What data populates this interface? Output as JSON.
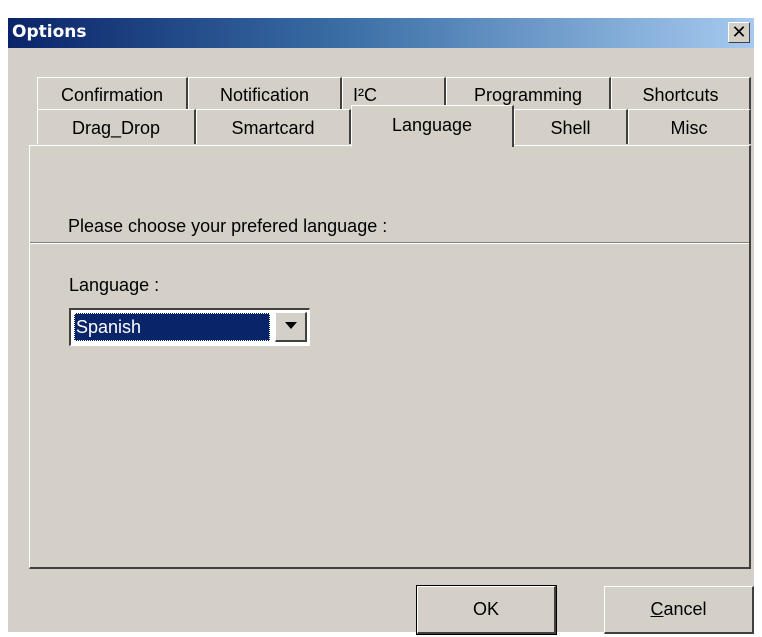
{
  "window": {
    "title": "Options",
    "close_glyph": "✕"
  },
  "tabs": {
    "row1": [
      {
        "label": "Confirmation"
      },
      {
        "label": "Notification"
      },
      {
        "label": "I²C"
      },
      {
        "label": "Programming"
      },
      {
        "label": "Shortcuts"
      }
    ],
    "row2": [
      {
        "label": "Drag_Drop"
      },
      {
        "label": "Smartcard"
      },
      {
        "label": "Language",
        "selected": true
      },
      {
        "label": "Shell"
      },
      {
        "label": "Misc"
      }
    ]
  },
  "panel": {
    "prompt": "Please choose your prefered language :",
    "language_label": "Language :",
    "language_value": "Spanish"
  },
  "buttons": {
    "ok_label": "OK",
    "cancel_label_first": "C",
    "cancel_label_rest": "ancel"
  },
  "icons": {
    "close": "close-icon",
    "dropdown": "chevron-down-icon"
  },
  "colors": {
    "titlebar_start": "#0a246a",
    "titlebar_end": "#a6caf0",
    "face": "#d4d0c8",
    "selection": "#0a246a"
  }
}
